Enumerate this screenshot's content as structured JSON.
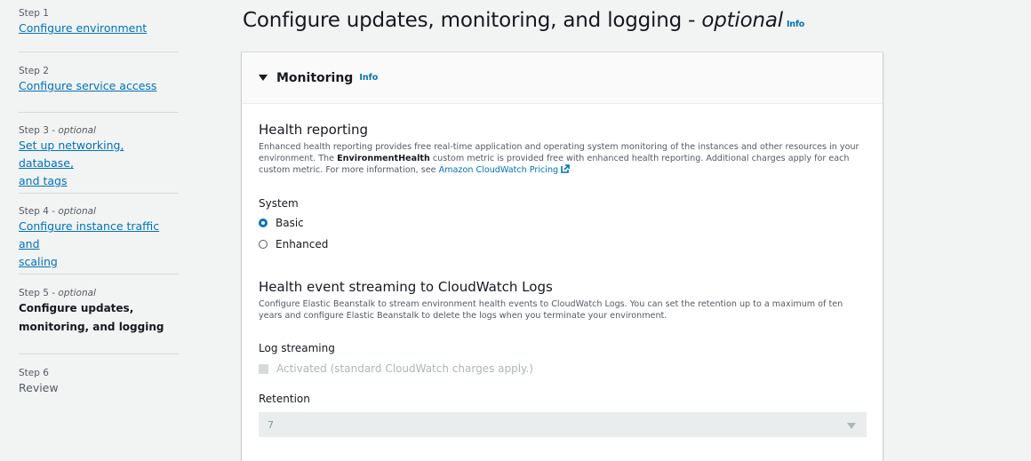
{
  "sidebar": {
    "steps": [
      {
        "label": "Step 1",
        "title": "Configure environment"
      },
      {
        "label": "Step 2",
        "title": "Configure service access"
      },
      {
        "label": "Step 3",
        "optional": "optional",
        "title_line1": "Set up networking, database,",
        "title_line2": "and tags"
      },
      {
        "label": "Step 4",
        "optional": "optional",
        "title_line1": "Configure instance traffic and",
        "title_line2": "scaling"
      },
      {
        "label": "Step 5",
        "optional": "optional",
        "title_line1": "Configure updates,",
        "title_line2": "monitoring, and logging"
      },
      {
        "label": "Step 6",
        "title": "Review"
      }
    ],
    "separator": " - "
  },
  "header": {
    "title": "Configure updates, monitoring, and logging - ",
    "title_optional": "optional",
    "info": "Info"
  },
  "panel": {
    "title": "Monitoring",
    "info": "Info",
    "health_reporting": {
      "heading": "Health reporting",
      "desc_part1": "Enhanced health reporting provides free real-time application and operating system monitoring of the instances and other resources in your environment. The ",
      "desc_bold": "EnvironmentHealth",
      "desc_part2": " custom metric is provided free with enhanced health reporting. Additional charges apply for each custom metric. For more information, see ",
      "desc_link": "Amazon CloudWatch Pricing"
    },
    "system": {
      "label": "System",
      "options": [
        "Basic",
        "Enhanced"
      ],
      "selected": "Basic"
    },
    "health_event_streaming": {
      "heading": "Health event streaming to CloudWatch Logs",
      "desc": "Configure Elastic Beanstalk to stream environment health events to CloudWatch Logs. You can set the retention up to a maximum of ten years and configure Elastic Beanstalk to delete the logs when you terminate your environment."
    },
    "log_streaming": {
      "label": "Log streaming",
      "checkbox": "Activated (standard CloudWatch charges apply.)"
    },
    "retention": {
      "label": "Retention",
      "value": "7"
    }
  },
  "colors": {
    "accent": "#0073bb",
    "background": "#f2f3f3",
    "text": "#16191f"
  }
}
